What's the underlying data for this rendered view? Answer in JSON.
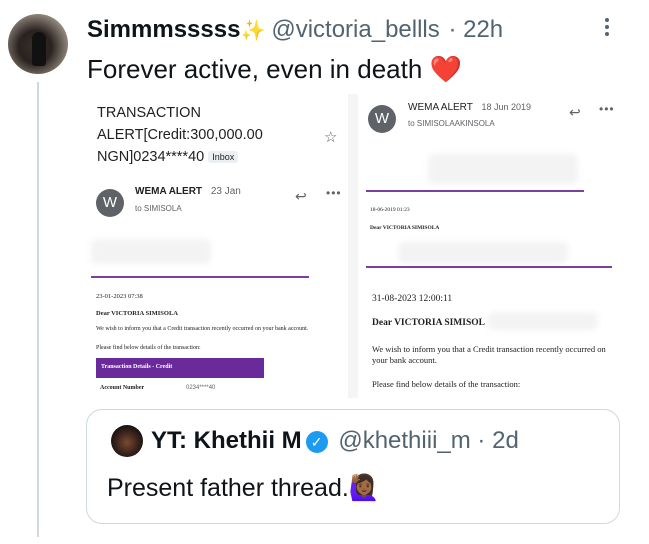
{
  "tweet": {
    "display_name": "Simmmsssss",
    "name_emoji": "✨",
    "handle": "@victoria_bellls",
    "separator": "·",
    "time": "22h",
    "text": "Forever active, even in death",
    "text_emoji": "❤️"
  },
  "email_left": {
    "subject": "TRANSACTION ALERT[Credit:300,000.00 NGN]0234****40",
    "label": "Inbox",
    "sender": "WEMA ALERT",
    "date": "23 Jan",
    "to": "to SIMISOLA",
    "avatar_letter": "W",
    "timestamp": "23-01-2023 07:38",
    "greeting": "Dear VICTORIA SIMISOLA",
    "body1": "We wish to inform you that a Credit transaction recently occurred on your bank account.",
    "body2": "Please find below details of the transaction:",
    "details_header": "Transaction Details - Credit",
    "account_label": "Account Number",
    "account_value": "0234****40"
  },
  "email_right": {
    "sender": "WEMA ALERT",
    "date": "18 Jun 2019",
    "to": "to SIMISOLAAKINSOLA",
    "avatar_letter": "W",
    "small_timestamp": "18-06-2019 01:23",
    "small_greeting": "Dear VICTORIA SIMISOLA",
    "timestamp": "31-08-2023 12:00:11",
    "greeting": "Dear VICTORIA SIMISOL",
    "body1": "We wish to inform you that a Credit transaction recently occurred on your bank account.",
    "body2": "Please find below details of the transaction:"
  },
  "quote": {
    "display_name": "YT: Khethii M",
    "handle": "@khethiii_m",
    "separator": "·",
    "time": "2d",
    "text": "Present father thread.",
    "text_emoji": "🙋🏾‍♀️"
  },
  "icons": {
    "more": "more-vertical-icon",
    "reply": "reply-arrow-icon",
    "star": "star-icon",
    "verified": "verified-badge-icon"
  },
  "colors": {
    "brand_purple": "#7a3fa0",
    "verified_blue": "#1d9bf0",
    "heart_red": "#e0245e"
  }
}
